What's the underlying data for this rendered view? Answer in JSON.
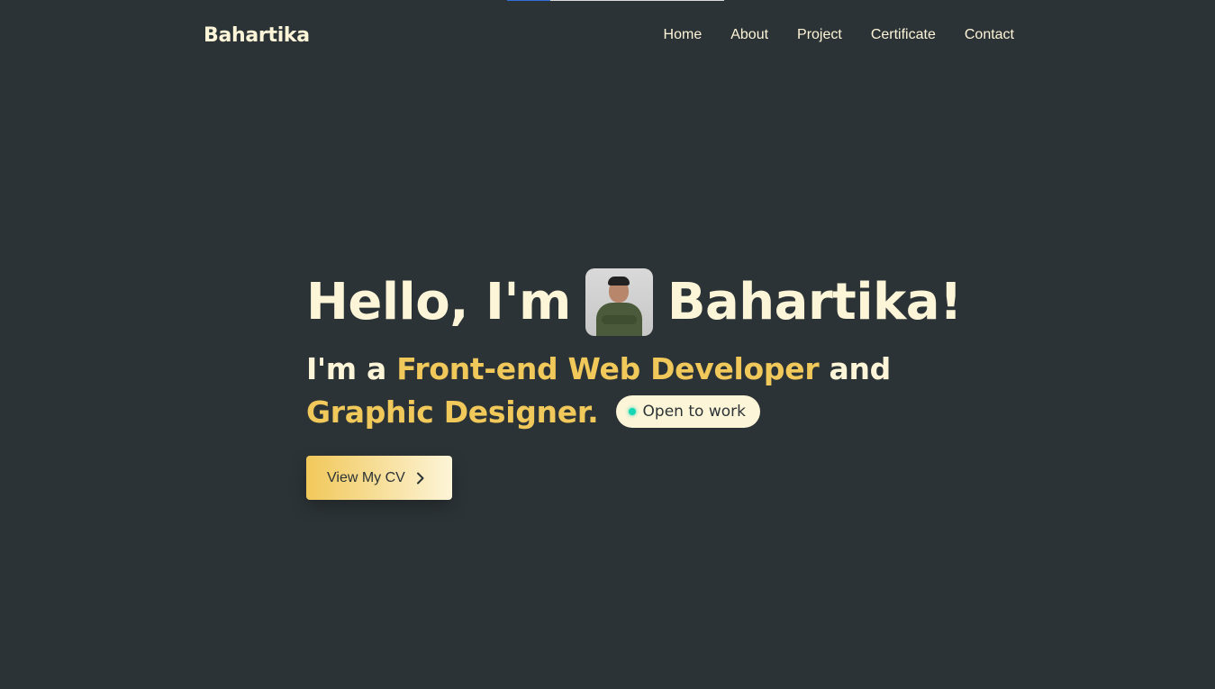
{
  "progress": {
    "fraction": 0.2
  },
  "brand": "Bahartika",
  "nav": {
    "items": [
      "Home",
      "About",
      "Project",
      "Certificate",
      "Contact"
    ]
  },
  "hero": {
    "greeting": "Hello, I'm",
    "name": "Bahartika!",
    "role_prefix": "I'm a",
    "role_primary": "Front-end Web Developer",
    "role_joiner": "and",
    "role_secondary": "Graphic Designer.",
    "status_badge": "Open to work",
    "cv_button": "View My CV"
  },
  "colors": {
    "background": "#2c3336",
    "text": "#fdf5d8",
    "accent": "#f1c85a",
    "status_dot": "#17d6b5",
    "progress": "#2f6fd6"
  },
  "icons": {
    "cv_button": "chevron-right-icon",
    "status": "dot-icon"
  }
}
